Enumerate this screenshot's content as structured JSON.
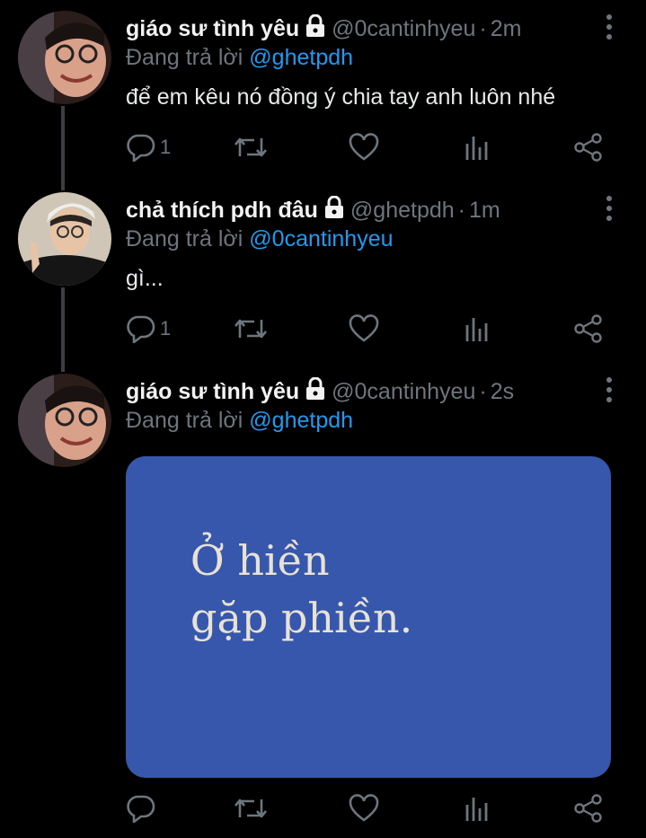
{
  "tweets": [
    {
      "name": "giáo sư tình yêu",
      "handle": "@0cantinhyeu",
      "separator": "·",
      "time": "2m",
      "replying_prefix": "Đang trả lời",
      "replying_to": "@ghetpdh",
      "text": "để em kêu nó đồng ý chia tay anh luôn nhé",
      "reply_count": "1",
      "avatar": "avatar-1"
    },
    {
      "name": "chả thích pdh đâu",
      "handle": "@ghetpdh",
      "separator": "·",
      "time": "1m",
      "replying_prefix": "Đang trả lời",
      "replying_to": "@0cantinhyeu",
      "text": "gì...",
      "reply_count": "1",
      "avatar": "avatar-2"
    },
    {
      "name": "giáo sư tình yêu",
      "handle": "@0cantinhyeu",
      "separator": "·",
      "time": "2s",
      "replying_prefix": "Đang trả lời",
      "replying_to": "@ghetpdh",
      "media_lines": [
        "Ở hiền",
        "gặp phiền."
      ],
      "reply_count": "",
      "avatar": "avatar-1"
    }
  ],
  "colors": {
    "background": "#000000",
    "text": "#e7e9ea",
    "muted": "#6e767d",
    "mention": "#1d9bf0",
    "media_bg": "#3757ad"
  },
  "icons": [
    "reply-icon",
    "retweet-icon",
    "like-icon",
    "analytics-icon",
    "share-icon",
    "lock-icon",
    "more-icon"
  ]
}
